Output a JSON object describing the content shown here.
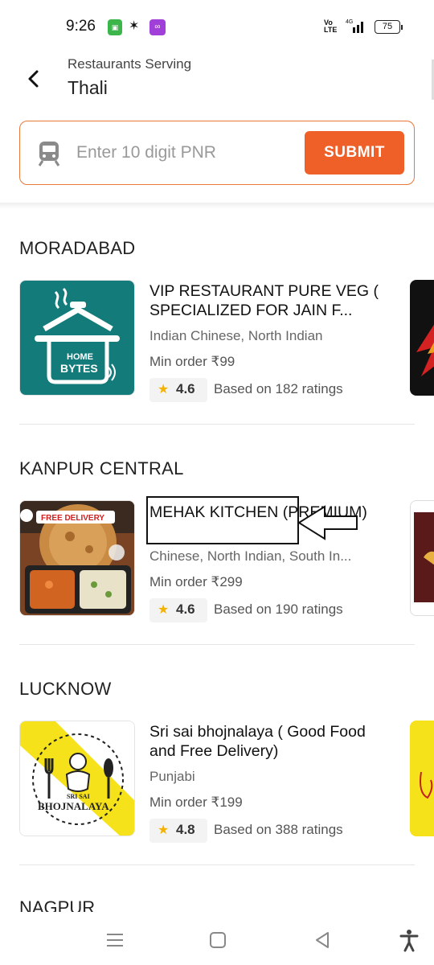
{
  "status_bar": {
    "time": "9:26",
    "volte": "Vo LTE",
    "network": "4G",
    "battery": "75"
  },
  "header": {
    "subtitle": "Restaurants Serving",
    "title": "Thali"
  },
  "pnr": {
    "placeholder": "Enter 10 digit PNR",
    "submit_label": "SUBMIT"
  },
  "sections": [
    {
      "city": "MORADABAD",
      "restaurant": {
        "name": "VIP RESTAURANT PURE VEG ( SPECIALIZED FOR JAIN F...",
        "cuisine": "Indian Chinese, North Indian",
        "min_order": "Min order ₹99",
        "rating": "4.6",
        "ratings_text": "Based on 182 ratings",
        "logo_text_1": "HOME",
        "logo_text_2": "BYTES"
      }
    },
    {
      "city": "KANPUR CENTRAL",
      "restaurant": {
        "name": "MEHAK KITCHEN (PREMIUM)",
        "cuisine": "Chinese, North Indian, South In...",
        "min_order": "Min order ₹299",
        "rating": "4.6",
        "ratings_text": "Based on 190 ratings",
        "badge": "FREE DELIVERY"
      }
    },
    {
      "city": "LUCKNOW",
      "restaurant": {
        "name": "Sri sai bhojnalaya  ( Good Food and Free Delivery)",
        "cuisine": "Punjabi",
        "min_order": "Min order ₹199",
        "rating": "4.8",
        "ratings_text": "Based on 388 ratings",
        "logo_text_1": "SRI SAI",
        "logo_text_2": "BHOJNALAYA"
      }
    }
  ],
  "next_city": "NAGPUR",
  "colors": {
    "accent": "#ef5f28",
    "teal": "#137c7b",
    "yellow": "#f5e21b",
    "star": "#f3b300"
  }
}
